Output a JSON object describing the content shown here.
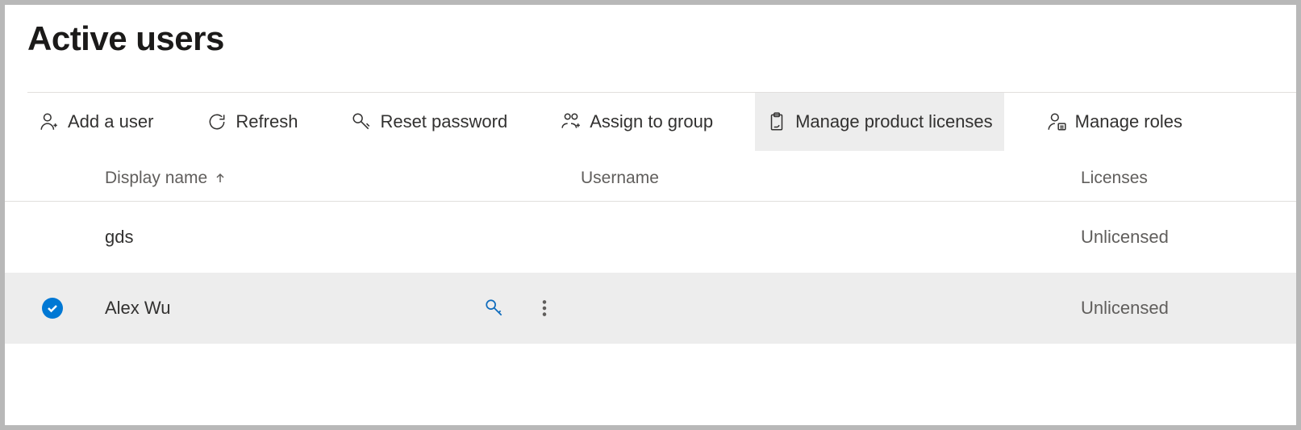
{
  "title": "Active users",
  "toolbar": {
    "add_user": "Add a user",
    "refresh": "Refresh",
    "reset_password": "Reset password",
    "assign_group": "Assign to group",
    "manage_licenses": "Manage product licenses",
    "manage_roles": "Manage roles"
  },
  "columns": {
    "display_name": "Display name",
    "username": "Username",
    "licenses": "Licenses"
  },
  "rows": [
    {
      "display_name": "gds",
      "username": "",
      "licenses": "Unlicensed",
      "selected": false
    },
    {
      "display_name": "Alex Wu",
      "username": "",
      "licenses": "Unlicensed",
      "selected": true
    }
  ]
}
